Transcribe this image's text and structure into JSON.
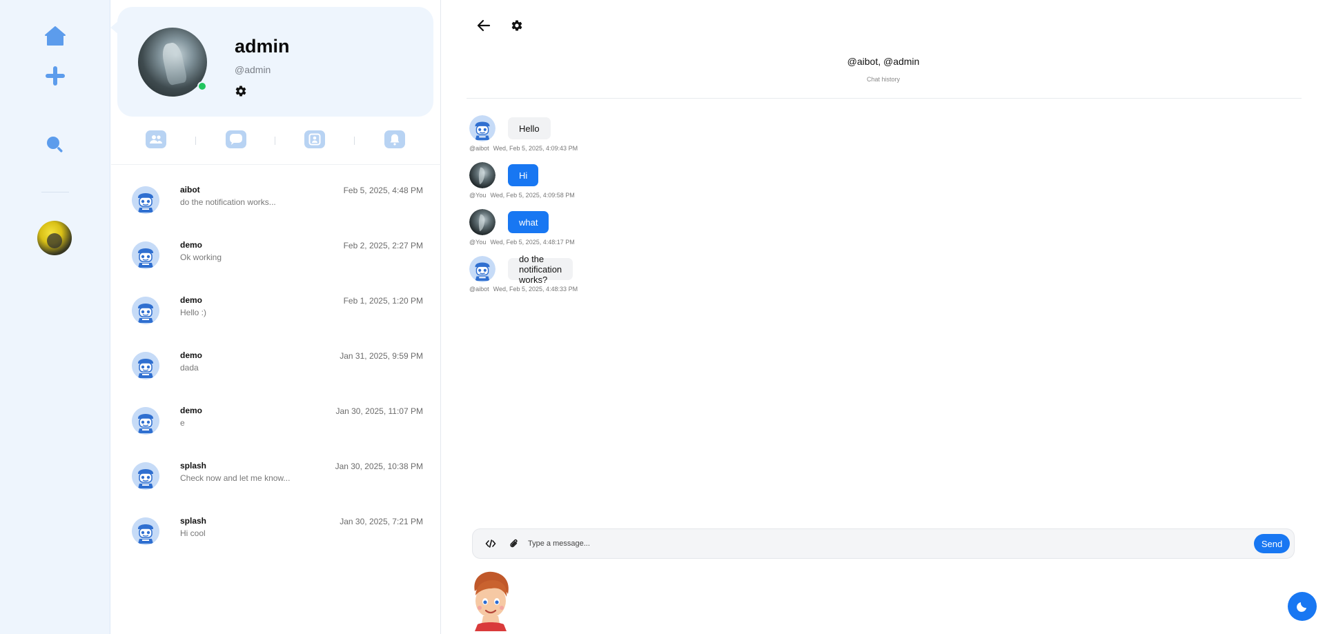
{
  "rail": {
    "items": [
      {
        "name": "home",
        "icon": "home-icon"
      },
      {
        "name": "new",
        "icon": "plus-icon"
      },
      {
        "name": "search",
        "icon": "search-icon"
      }
    ],
    "accent": "#5c9cec"
  },
  "profile": {
    "name": "admin",
    "handle": "@admin",
    "status": "online"
  },
  "tabs": [
    {
      "name": "groups",
      "icon": "users-icon"
    },
    {
      "name": "messages",
      "icon": "chat-bubble-icon"
    },
    {
      "name": "contacts",
      "icon": "contact-card-icon"
    },
    {
      "name": "notifications",
      "icon": "bell-icon"
    }
  ],
  "conversations": [
    {
      "name": "aibot",
      "preview": "do the notification works...",
      "date": "Feb 5, 2025, 4:48 PM"
    },
    {
      "name": "demo",
      "preview": "Ok working",
      "date": "Feb 2, 2025, 2:27 PM"
    },
    {
      "name": "demo",
      "preview": "Hello :)",
      "date": "Feb 1, 2025, 1:20 PM"
    },
    {
      "name": "demo",
      "preview": "dada",
      "date": "Jan 31, 2025, 9:59 PM"
    },
    {
      "name": "demo",
      "preview": "e",
      "date": "Jan 30, 2025, 11:07 PM"
    },
    {
      "name": "splash",
      "preview": "Check now and let me know...",
      "date": "Jan 30, 2025, 10:38 PM"
    },
    {
      "name": "splash",
      "preview": "Hi cool",
      "date": "Jan 30, 2025, 7:21 PM"
    }
  ],
  "chat": {
    "title": "@aibot, @admin",
    "subtitle": "Chat history",
    "messages": [
      {
        "sender": "@aibot",
        "text": "Hello",
        "time": "Wed, Feb 5, 2025, 4:09:43 PM",
        "outgoing": false
      },
      {
        "sender": "@You",
        "text": "Hi",
        "time": "Wed, Feb 5, 2025, 4:09:58 PM",
        "outgoing": true
      },
      {
        "sender": "@You",
        "text": "what",
        "time": "Wed, Feb 5, 2025, 4:48:17 PM",
        "outgoing": true
      },
      {
        "sender": "@aibot",
        "text": "do the notification works?",
        "time": "Wed, Feb 5, 2025, 4:48:33 PM",
        "outgoing": false
      }
    ],
    "composer": {
      "placeholder": "Type a message...",
      "send_label": "Send"
    }
  },
  "colors": {
    "primary": "#1877f2",
    "rail_bg": "#eef5fd",
    "online": "#22c55e"
  }
}
